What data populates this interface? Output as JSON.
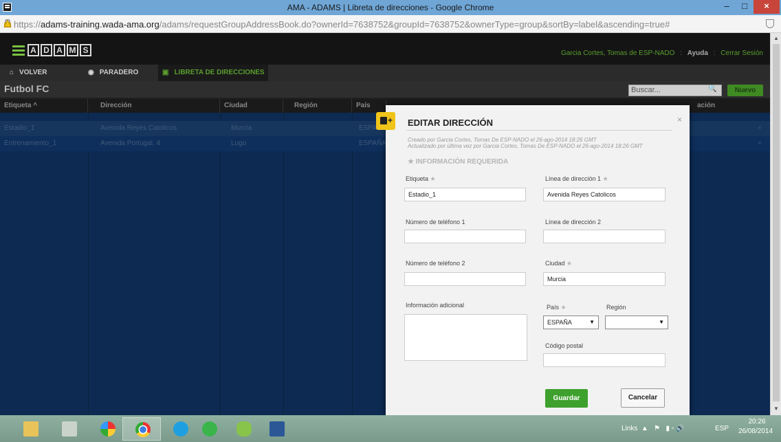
{
  "window": {
    "title": "AMA - ADAMS | Libreta de direcciones - Google Chrome",
    "minimize": "‒",
    "maximize": "□",
    "close": "×"
  },
  "browser": {
    "url_prefix": "https://",
    "url_domain": "adams-training.wada-ama.org",
    "url_path": "/adams/requestGroupAddressBook.do?ownerId=7638752&groupId=7638752&ownerType=group&sortBy=label&ascending=true#"
  },
  "header": {
    "logo_letters": [
      "A",
      "D",
      "A",
      "M",
      "S"
    ],
    "user": "Garcia Cortes, Tomas de ESP-NADO",
    "help": "Ayuda",
    "logout": "Cerrar Sesión",
    "separator": ":"
  },
  "nav": {
    "back": "VOLVER",
    "whereabouts": "PARADERO",
    "address_book": "LIBRETA DE DIRECCIONES"
  },
  "section": {
    "title": "Futbol FC",
    "search_placeholder": "Buscar...",
    "new_label": "Nuevo"
  },
  "table": {
    "headers": [
      "Etiqueta ^",
      "Dirección",
      "Ciudad",
      "Región",
      "País",
      "ación"
    ],
    "rows": [
      {
        "label": "Estadio_1",
        "address": "Avenida Reyes Catolicos",
        "city": "Murcia",
        "country": "ESPA",
        "delete": "×"
      },
      {
        "label": "Entrenamiento_1",
        "address": "Avenida Portugal, 4",
        "city": "Lugo",
        "country": "ESPAÑA",
        "delete": "×"
      }
    ]
  },
  "modal": {
    "title": "EDITAR DIRECCIÓN",
    "close": "×",
    "created": "Creado por Garcia Cortes, Tomas De ESP-NADO el 26-ago-2014 18:26 GMT",
    "updated": "Actualizado por última vez por Garcia Cortes, Tomas De ESP-NADO el 26-ago-2014 18:26 GMT",
    "required_heading": "INFORMACIÓN REQUERIDA",
    "required_star": "★",
    "label_label": "Etiqueta",
    "label_value": "Estadio_1",
    "address1_label": "Línea de dirección 1",
    "address1_value": "Avenida Reyes Catolicos",
    "phone1_label": "Número de teléfono 1",
    "phone1_value": "",
    "address2_label": "Línea de dirección 2",
    "address2_value": "",
    "phone2_label": "Número de teléfono 2",
    "phone2_value": "",
    "city_label": "Ciudad",
    "city_value": "Murcia",
    "additional_label": "Información adicional",
    "country_label": "País",
    "country_value": "ESPAÑA",
    "region_label": "Región",
    "region_value": "",
    "postal_label": "Código postal",
    "postal_value": "",
    "save": "Guardar",
    "cancel": "Cancelar"
  },
  "taskbar": {
    "links": "Links",
    "language": "ESP",
    "time": "20:26",
    "date": "26/08/2014"
  },
  "colors": {
    "accent_green": "#3ea02d",
    "table_blue": "#0d2a52",
    "modal_icon_yellow": "#f0c419"
  }
}
